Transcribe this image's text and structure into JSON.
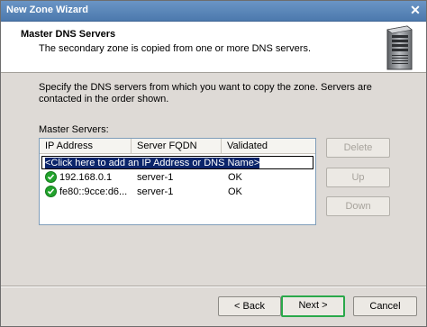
{
  "window": {
    "title": "New Zone Wizard"
  },
  "header": {
    "title": "Master DNS Servers",
    "subtitle": "The secondary zone is copied from one or more DNS servers."
  },
  "instructions": "Specify the DNS servers from which you want to copy the zone.  Servers are contacted in the order shown.",
  "master_servers": {
    "label": "Master Servers:",
    "columns": [
      "IP Address",
      "Server FQDN",
      "Validated"
    ],
    "add_placeholder": "<Click here to add an IP Address or DNS Name>",
    "rows": [
      {
        "ip": "192.168.0.1",
        "fqdn": "server-1",
        "validated": "OK",
        "icon": "ok-checkmark-icon"
      },
      {
        "ip": "fe80::9cce:d6...",
        "fqdn": "server-1",
        "validated": "OK",
        "icon": "ok-checkmark-icon"
      }
    ]
  },
  "side_buttons": {
    "delete": "Delete",
    "up": "Up",
    "down": "Down"
  },
  "footer": {
    "back": "< Back",
    "next": "Next >",
    "cancel": "Cancel"
  },
  "colors": {
    "title_bar": "#4c79ad",
    "dialog_bg": "#dedad6",
    "ok_green": "#22a32c",
    "next_highlight": "#2aa84a"
  }
}
